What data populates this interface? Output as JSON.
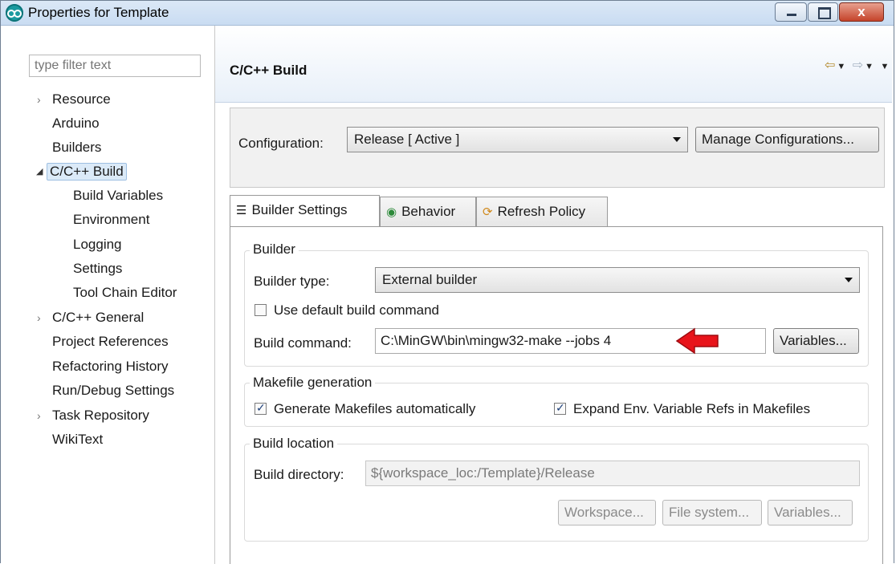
{
  "window": {
    "title": "Properties for Template"
  },
  "titlebar": {
    "minimize": "",
    "maximize": "",
    "close": "x"
  },
  "filter": {
    "placeholder": "type filter text"
  },
  "tree": {
    "resource": "Resource",
    "arduino": "Arduino",
    "builders": "Builders",
    "cpp_build": "C/C++ Build",
    "build_variables": "Build Variables",
    "environment": "Environment",
    "logging": "Logging",
    "settings": "Settings",
    "tool_chain_editor": "Tool Chain Editor",
    "cpp_general": "C/C++ General",
    "project_references": "Project References",
    "refactoring_history": "Refactoring History",
    "run_debug_settings": "Run/Debug Settings",
    "task_repository": "Task Repository",
    "wikitext": "WikiText"
  },
  "page": {
    "title": "C/C++ Build"
  },
  "configuration": {
    "label": "Configuration:",
    "value": "Release  [ Active ]",
    "manage_button": "Manage Configurations..."
  },
  "tabs": {
    "builder_settings": "Builder Settings",
    "behavior": "Behavior",
    "refresh_policy": "Refresh Policy"
  },
  "builder": {
    "group_title": "Builder",
    "type_label": "Builder type:",
    "type_value": "External builder",
    "use_default_label": "Use default build command",
    "use_default_checked": false,
    "command_label": "Build command:",
    "command_value": "C:\\MinGW\\bin\\mingw32-make --jobs 4",
    "variables_button": "Variables..."
  },
  "makefile": {
    "group_title": "Makefile generation",
    "generate_label": "Generate Makefiles automatically",
    "generate_checked": true,
    "expand_label": "Expand Env. Variable Refs in Makefiles",
    "expand_checked": true
  },
  "location": {
    "group_title": "Build location",
    "directory_label": "Build directory:",
    "directory_value": "${workspace_loc:/Template}/Release",
    "workspace_button": "Workspace...",
    "filesystem_button": "File system...",
    "variables_button": "Variables..."
  },
  "colors": {
    "highlight_arrow": "#e8141b",
    "selection": "#dbeaf8"
  }
}
